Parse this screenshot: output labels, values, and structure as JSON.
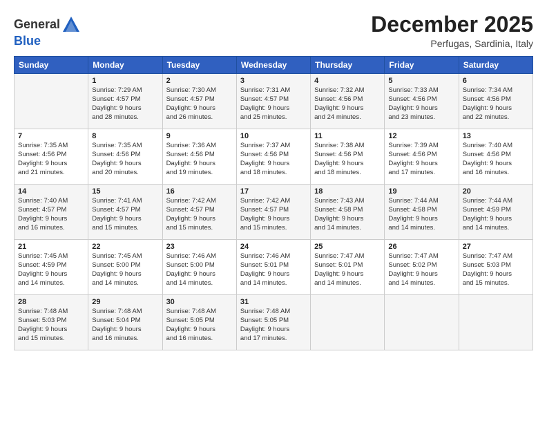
{
  "header": {
    "logo_line1": "General",
    "logo_line2": "Blue",
    "month": "December 2025",
    "location": "Perfugas, Sardinia, Italy"
  },
  "weekdays": [
    "Sunday",
    "Monday",
    "Tuesday",
    "Wednesday",
    "Thursday",
    "Friday",
    "Saturday"
  ],
  "weeks": [
    [
      {
        "day": "",
        "info": ""
      },
      {
        "day": "1",
        "info": "Sunrise: 7:29 AM\nSunset: 4:57 PM\nDaylight: 9 hours\nand 28 minutes."
      },
      {
        "day": "2",
        "info": "Sunrise: 7:30 AM\nSunset: 4:57 PM\nDaylight: 9 hours\nand 26 minutes."
      },
      {
        "day": "3",
        "info": "Sunrise: 7:31 AM\nSunset: 4:57 PM\nDaylight: 9 hours\nand 25 minutes."
      },
      {
        "day": "4",
        "info": "Sunrise: 7:32 AM\nSunset: 4:56 PM\nDaylight: 9 hours\nand 24 minutes."
      },
      {
        "day": "5",
        "info": "Sunrise: 7:33 AM\nSunset: 4:56 PM\nDaylight: 9 hours\nand 23 minutes."
      },
      {
        "day": "6",
        "info": "Sunrise: 7:34 AM\nSunset: 4:56 PM\nDaylight: 9 hours\nand 22 minutes."
      }
    ],
    [
      {
        "day": "7",
        "info": "Sunrise: 7:35 AM\nSunset: 4:56 PM\nDaylight: 9 hours\nand 21 minutes."
      },
      {
        "day": "8",
        "info": "Sunrise: 7:35 AM\nSunset: 4:56 PM\nDaylight: 9 hours\nand 20 minutes."
      },
      {
        "day": "9",
        "info": "Sunrise: 7:36 AM\nSunset: 4:56 PM\nDaylight: 9 hours\nand 19 minutes."
      },
      {
        "day": "10",
        "info": "Sunrise: 7:37 AM\nSunset: 4:56 PM\nDaylight: 9 hours\nand 18 minutes."
      },
      {
        "day": "11",
        "info": "Sunrise: 7:38 AM\nSunset: 4:56 PM\nDaylight: 9 hours\nand 18 minutes."
      },
      {
        "day": "12",
        "info": "Sunrise: 7:39 AM\nSunset: 4:56 PM\nDaylight: 9 hours\nand 17 minutes."
      },
      {
        "day": "13",
        "info": "Sunrise: 7:40 AM\nSunset: 4:56 PM\nDaylight: 9 hours\nand 16 minutes."
      }
    ],
    [
      {
        "day": "14",
        "info": "Sunrise: 7:40 AM\nSunset: 4:57 PM\nDaylight: 9 hours\nand 16 minutes."
      },
      {
        "day": "15",
        "info": "Sunrise: 7:41 AM\nSunset: 4:57 PM\nDaylight: 9 hours\nand 15 minutes."
      },
      {
        "day": "16",
        "info": "Sunrise: 7:42 AM\nSunset: 4:57 PM\nDaylight: 9 hours\nand 15 minutes."
      },
      {
        "day": "17",
        "info": "Sunrise: 7:42 AM\nSunset: 4:57 PM\nDaylight: 9 hours\nand 15 minutes."
      },
      {
        "day": "18",
        "info": "Sunrise: 7:43 AM\nSunset: 4:58 PM\nDaylight: 9 hours\nand 14 minutes."
      },
      {
        "day": "19",
        "info": "Sunrise: 7:44 AM\nSunset: 4:58 PM\nDaylight: 9 hours\nand 14 minutes."
      },
      {
        "day": "20",
        "info": "Sunrise: 7:44 AM\nSunset: 4:59 PM\nDaylight: 9 hours\nand 14 minutes."
      }
    ],
    [
      {
        "day": "21",
        "info": "Sunrise: 7:45 AM\nSunset: 4:59 PM\nDaylight: 9 hours\nand 14 minutes."
      },
      {
        "day": "22",
        "info": "Sunrise: 7:45 AM\nSunset: 5:00 PM\nDaylight: 9 hours\nand 14 minutes."
      },
      {
        "day": "23",
        "info": "Sunrise: 7:46 AM\nSunset: 5:00 PM\nDaylight: 9 hours\nand 14 minutes."
      },
      {
        "day": "24",
        "info": "Sunrise: 7:46 AM\nSunset: 5:01 PM\nDaylight: 9 hours\nand 14 minutes."
      },
      {
        "day": "25",
        "info": "Sunrise: 7:47 AM\nSunset: 5:01 PM\nDaylight: 9 hours\nand 14 minutes."
      },
      {
        "day": "26",
        "info": "Sunrise: 7:47 AM\nSunset: 5:02 PM\nDaylight: 9 hours\nand 14 minutes."
      },
      {
        "day": "27",
        "info": "Sunrise: 7:47 AM\nSunset: 5:03 PM\nDaylight: 9 hours\nand 15 minutes."
      }
    ],
    [
      {
        "day": "28",
        "info": "Sunrise: 7:48 AM\nSunset: 5:03 PM\nDaylight: 9 hours\nand 15 minutes."
      },
      {
        "day": "29",
        "info": "Sunrise: 7:48 AM\nSunset: 5:04 PM\nDaylight: 9 hours\nand 16 minutes."
      },
      {
        "day": "30",
        "info": "Sunrise: 7:48 AM\nSunset: 5:05 PM\nDaylight: 9 hours\nand 16 minutes."
      },
      {
        "day": "31",
        "info": "Sunrise: 7:48 AM\nSunset: 5:05 PM\nDaylight: 9 hours\nand 17 minutes."
      },
      {
        "day": "",
        "info": ""
      },
      {
        "day": "",
        "info": ""
      },
      {
        "day": "",
        "info": ""
      }
    ]
  ]
}
